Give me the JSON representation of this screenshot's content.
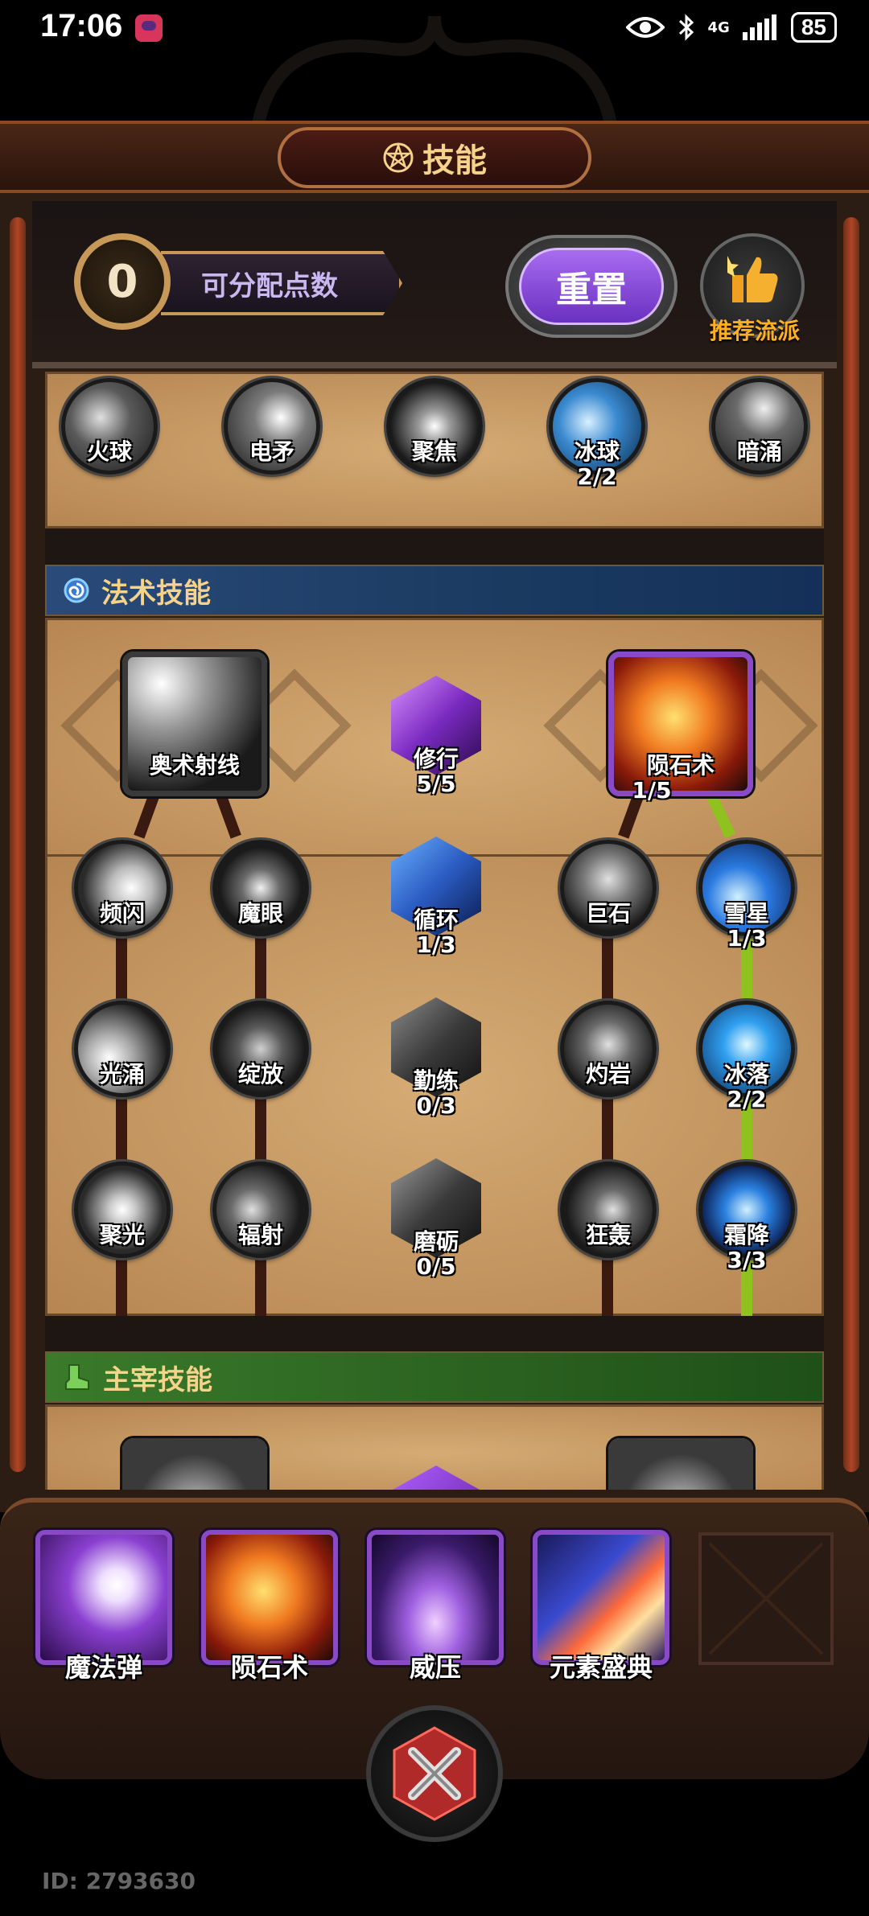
{
  "status_bar": {
    "time": "17:06",
    "network": "4G",
    "battery": "85"
  },
  "header": {
    "title": "技能"
  },
  "points": {
    "value": "0",
    "label": "可分配点数"
  },
  "reset_button": {
    "label": "重置"
  },
  "recommend": {
    "label": "推荐流派"
  },
  "top_skills": [
    {
      "name": "火球",
      "count": ""
    },
    {
      "name": "电矛",
      "count": ""
    },
    {
      "name": "聚焦",
      "count": ""
    },
    {
      "name": "冰球",
      "count": "2/2"
    },
    {
      "name": "暗涌",
      "count": ""
    }
  ],
  "spell_section": {
    "title": "法术技能"
  },
  "spell_skills": {
    "arcane_ray": {
      "name": "奥术射线"
    },
    "practice": {
      "name": "修行",
      "count": "5/5"
    },
    "meteor": {
      "name": "陨石术",
      "count": "1/5"
    },
    "blink": {
      "name": "频闪"
    },
    "evil_eye": {
      "name": "魔眼"
    },
    "cycle": {
      "name": "循环",
      "count": "1/3"
    },
    "boulder": {
      "name": "巨石"
    },
    "snow_star": {
      "name": "雪星",
      "count": "1/3"
    },
    "light_surge": {
      "name": "光涌"
    },
    "bloom": {
      "name": "绽放"
    },
    "diligence": {
      "name": "勤练",
      "count": "0/3"
    },
    "scorch_rock": {
      "name": "灼岩"
    },
    "ice_fall": {
      "name": "冰落",
      "count": "2/2"
    },
    "focus_light": {
      "name": "聚光"
    },
    "radiate": {
      "name": "辐射"
    },
    "hone": {
      "name": "磨砺",
      "count": "0/5"
    },
    "rampage": {
      "name": "狂轰"
    },
    "frost": {
      "name": "霜降",
      "count": "3/3"
    }
  },
  "master_section": {
    "title": "主宰技能"
  },
  "equipped": [
    {
      "name": "魔法弹"
    },
    {
      "name": "陨石术"
    },
    {
      "name": "威压"
    },
    {
      "name": "元素盛典"
    }
  ],
  "footer": {
    "id": "ID: 2793630"
  },
  "colors": {
    "accent_purple": "#8a4ac8",
    "title_gold": "#f6d38a",
    "path_green": "#8fc21e",
    "recommend_orange": "#ffb020"
  }
}
